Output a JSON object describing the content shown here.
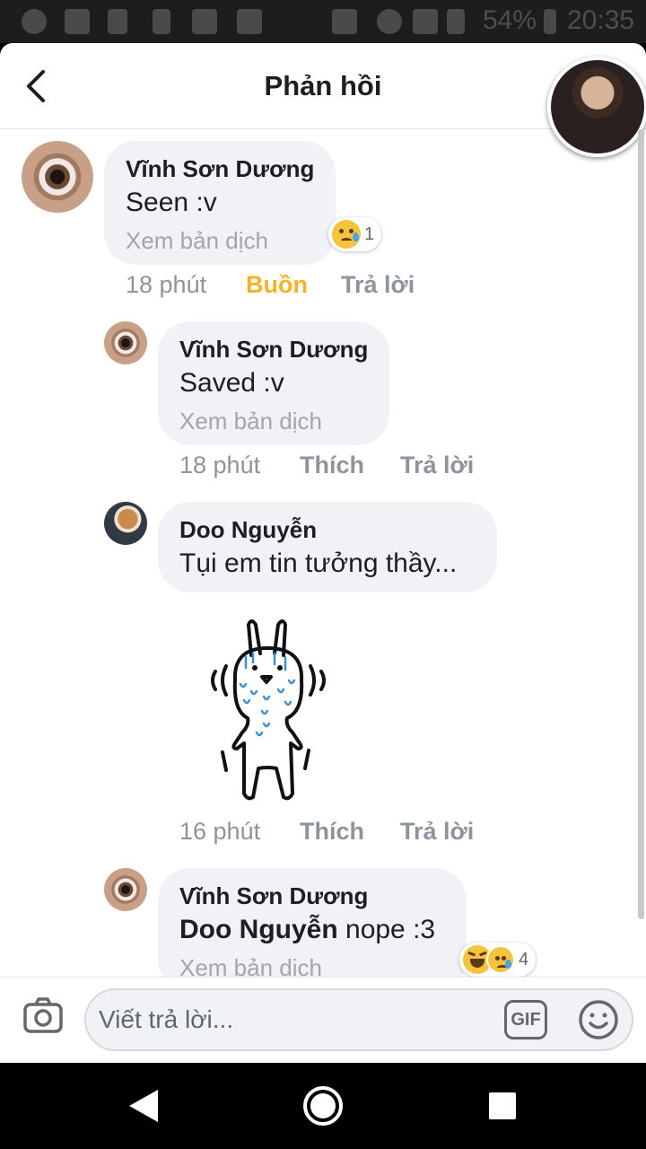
{
  "status_bar": {
    "battery": "54%",
    "time": "20:35"
  },
  "header": {
    "title": "Phản hồi"
  },
  "comments": [
    {
      "author": "Vĩnh Sơn Dương",
      "text": "Seen :v",
      "translate": "Xem bản dịch",
      "time": "18 phút",
      "action_react": "Buồn",
      "action_reply": "Trả lời",
      "reaction_count": "1"
    },
    {
      "author": "Vĩnh Sơn Dương",
      "text": "Saved :v",
      "translate": "Xem bản dịch",
      "time": "18 phút",
      "action_react": "Thích",
      "action_reply": "Trả lời"
    },
    {
      "author": "Doo Nguyễn",
      "text": "Tụi em tin tưởng thầy...",
      "time": "16 phút",
      "action_react": "Thích",
      "action_reply": "Trả lời"
    },
    {
      "author": "Vĩnh Sơn Dương",
      "mention": "Doo Nguyễn",
      "text": " nope :3",
      "translate": "Xem bản dịch",
      "reaction_count": "4"
    }
  ],
  "composer": {
    "placeholder": "Viết trả lời...",
    "gif_label": "GIF"
  },
  "colors": {
    "reacted": "#f7b125",
    "bubble": "#f0f2f5",
    "muted": "#8d949e"
  },
  "icons": [
    "back-arrow-icon",
    "camera-icon",
    "gif-icon",
    "smiley-icon",
    "sad-reaction-icon",
    "haha-reaction-icon",
    "nav-back-icon",
    "nav-home-icon",
    "nav-recents-icon"
  ]
}
